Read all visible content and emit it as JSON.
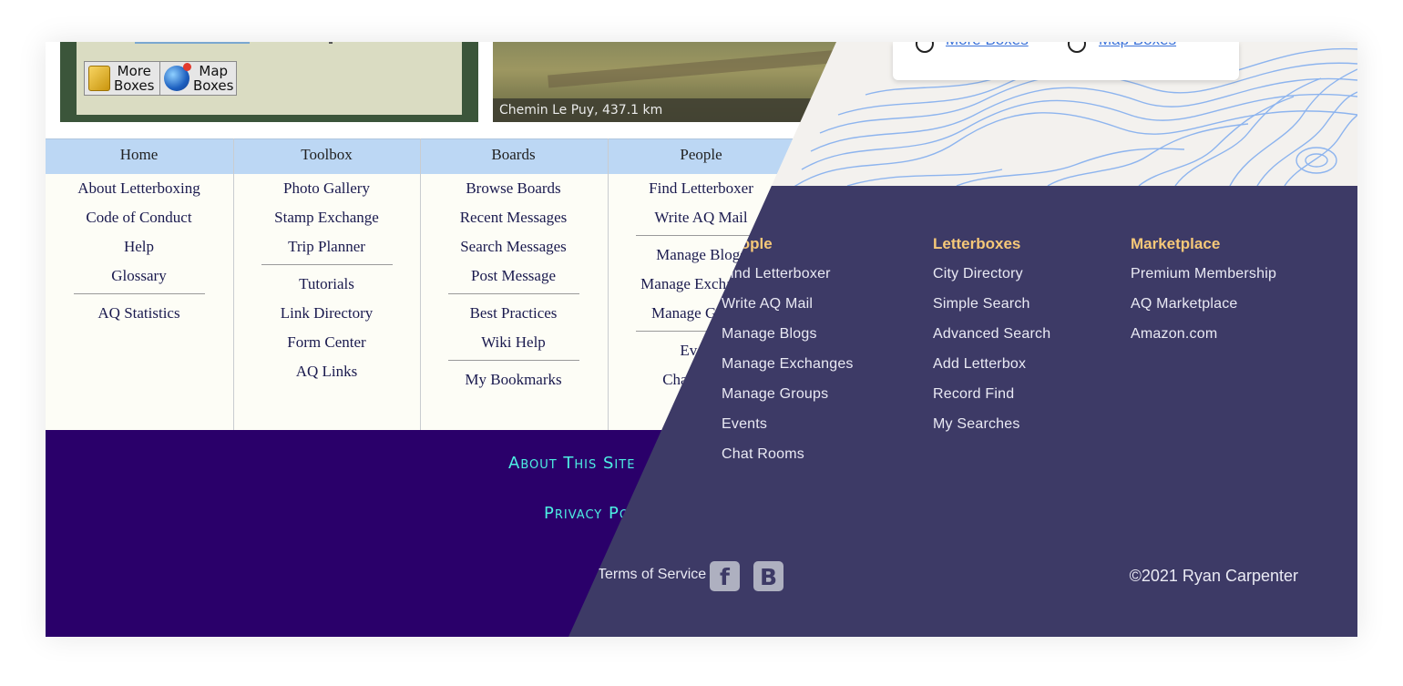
{
  "old_site": {
    "box_buttons": [
      {
        "label": "More\nBoxes",
        "icon": "box-icon"
      },
      {
        "label": "Map\nBoxes",
        "icon": "globe-icon"
      }
    ],
    "photo_caption": "Chemin Le Puy, 437.1 km",
    "menu": [
      {
        "header": "Home",
        "groups": [
          [
            "About Letterboxing",
            "Code of Conduct",
            "Help",
            "Glossary"
          ],
          [
            "AQ Statistics"
          ]
        ]
      },
      {
        "header": "Toolbox",
        "groups": [
          [
            "Photo Gallery",
            "Stamp Exchange",
            "Trip Planner"
          ],
          [
            "Tutorials",
            "Link Directory",
            "Form Center",
            "AQ Links"
          ]
        ]
      },
      {
        "header": "Boards",
        "groups": [
          [
            "Browse Boards",
            "Recent Messages",
            "Search Messages",
            "Post Message"
          ],
          [
            "Best Practices",
            "Wiki Help"
          ],
          [
            "My Bookmarks"
          ]
        ]
      },
      {
        "header": "People",
        "groups": [
          [
            "Find Letterboxer",
            "Write AQ Mail"
          ],
          [
            "Manage Blogs",
            "Manage Exchanges",
            "Manage Groups"
          ],
          [
            "Events",
            "Chat Rooms"
          ]
        ]
      }
    ],
    "footer_links": [
      "About This Site",
      "Privacy Policy"
    ]
  },
  "new_site": {
    "popup_links": [
      "More Boxes",
      "Map Boxes"
    ],
    "columns": [
      {
        "header": "People",
        "items": [
          "Find Letterboxer",
          "Write AQ Mail",
          "Manage Blogs",
          "Manage Exchanges",
          "Manage Groups",
          "Events",
          "Chat Rooms"
        ]
      },
      {
        "header": "Letterboxes",
        "items": [
          "City Directory",
          "Simple Search",
          "Advanced Search",
          "Add Letterbox",
          "Record Find",
          "My Searches"
        ]
      },
      {
        "header": "Marketplace",
        "items": [
          "Premium Membership",
          "AQ Marketplace",
          "Amazon.com"
        ]
      }
    ],
    "terms": "Terms of Service",
    "social": [
      "facebook-icon",
      "blogger-icon"
    ],
    "copyright": "©2021 Ryan Carpenter"
  },
  "colors": {
    "old_footer": "#2a006a",
    "old_link": "#4df0e3",
    "new_footer": "#3d3a66",
    "new_heading": "#f6c878",
    "menu_header": "#bcd7f4"
  }
}
